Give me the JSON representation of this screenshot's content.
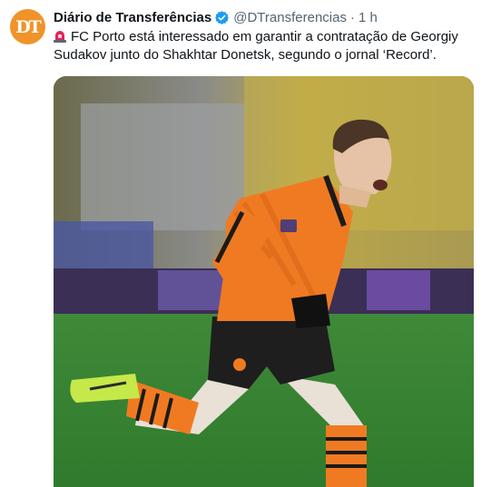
{
  "account": {
    "avatar_icon": "diario-de-transferencias-logo",
    "display_name": "Diário de Transferências",
    "verified_icon": "verified-badge-icon",
    "handle": "@DTransferencias",
    "separator": "·",
    "time": "1 h"
  },
  "tweet": {
    "emoji_icon": "police-siren-icon",
    "text": "FC Porto está interessado em garantir a contratação de Georgiy Sudakov junto do Shakhtar Donetsk, segundo o jornal ‘Record’."
  },
  "media": {
    "type": "photo",
    "subject": "player-celebrating-photo"
  },
  "colors": {
    "avatar_bg": "#f0932a",
    "verified": "#1d9bf0",
    "secondary_text": "#536471",
    "primary_text": "#0f1419",
    "kit_orange": "#f07a22"
  }
}
